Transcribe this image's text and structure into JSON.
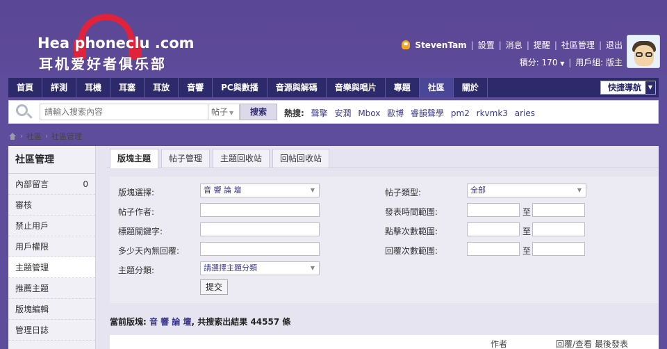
{
  "header": {
    "brand": "Hea  phoneclu  .com",
    "tagline": "耳机爱好者俱乐部",
    "user": {
      "name": "StevenTam",
      "links": [
        "設置",
        "消息",
        "提醒",
        "社區管理",
        "退出"
      ],
      "points_label": "積分: 170",
      "group_label": "用戶組: 版主"
    }
  },
  "nav": {
    "items": [
      "首頁",
      "評測",
      "耳機",
      "耳塞",
      "耳放",
      "音響",
      "PC與數播",
      "音源與解碼",
      "音樂與唱片",
      "專題",
      "社區",
      "關於"
    ],
    "active_index": 10,
    "quick_nav": "快捷導航"
  },
  "search": {
    "placeholder": "請輸入搜索內容",
    "type": "帖子",
    "button": "搜索",
    "hot_label": "熱搜:",
    "hot_words": [
      "聲擎",
      "安潤",
      "Mbox",
      "歐博",
      "睿韻聲學",
      "pm2",
      "rkvmk3",
      "aries"
    ]
  },
  "breadcrumb": [
    "社區",
    "社區管理"
  ],
  "sidebar": {
    "title": "社區管理",
    "items": [
      {
        "label": "內部留言",
        "count": "0"
      },
      {
        "label": "審核",
        "count": ""
      },
      {
        "label": "禁止用戶",
        "count": ""
      },
      {
        "label": "用戶權限",
        "count": ""
      },
      {
        "label": "主題管理",
        "count": ""
      },
      {
        "label": "推薦主題",
        "count": ""
      },
      {
        "label": "版塊編輯",
        "count": ""
      },
      {
        "label": "管理日誌",
        "count": ""
      }
    ],
    "active_index": 4
  },
  "tabs": {
    "items": [
      "版塊主題",
      "帖子管理",
      "主題回收站",
      "回帖回收站"
    ],
    "active_index": 0
  },
  "filter": {
    "forum_label": "版塊選擇:",
    "forum_value": "音 響 論 壇",
    "author_label": "帖子作者:",
    "keyword_label": "標題關鍵字:",
    "noreply_label": "多少天內無回覆:",
    "category_label": "主題分類:",
    "category_value": "請選擇主題分類",
    "post_type_label": "帖子類型:",
    "post_type_value": "全部",
    "time_label": "發表時間範圍:",
    "views_label": "點擊次數範圍:",
    "replies_label": "回覆次數範圍:",
    "to": "至",
    "submit": "提交"
  },
  "result": {
    "prefix": "當前版塊:",
    "forum": "音 響 論 壇",
    "suffix": ", 共搜索出結果 44557 條"
  },
  "table": {
    "author": "作者",
    "replies_views": "回覆/查看",
    "last_post": "最後發表"
  }
}
